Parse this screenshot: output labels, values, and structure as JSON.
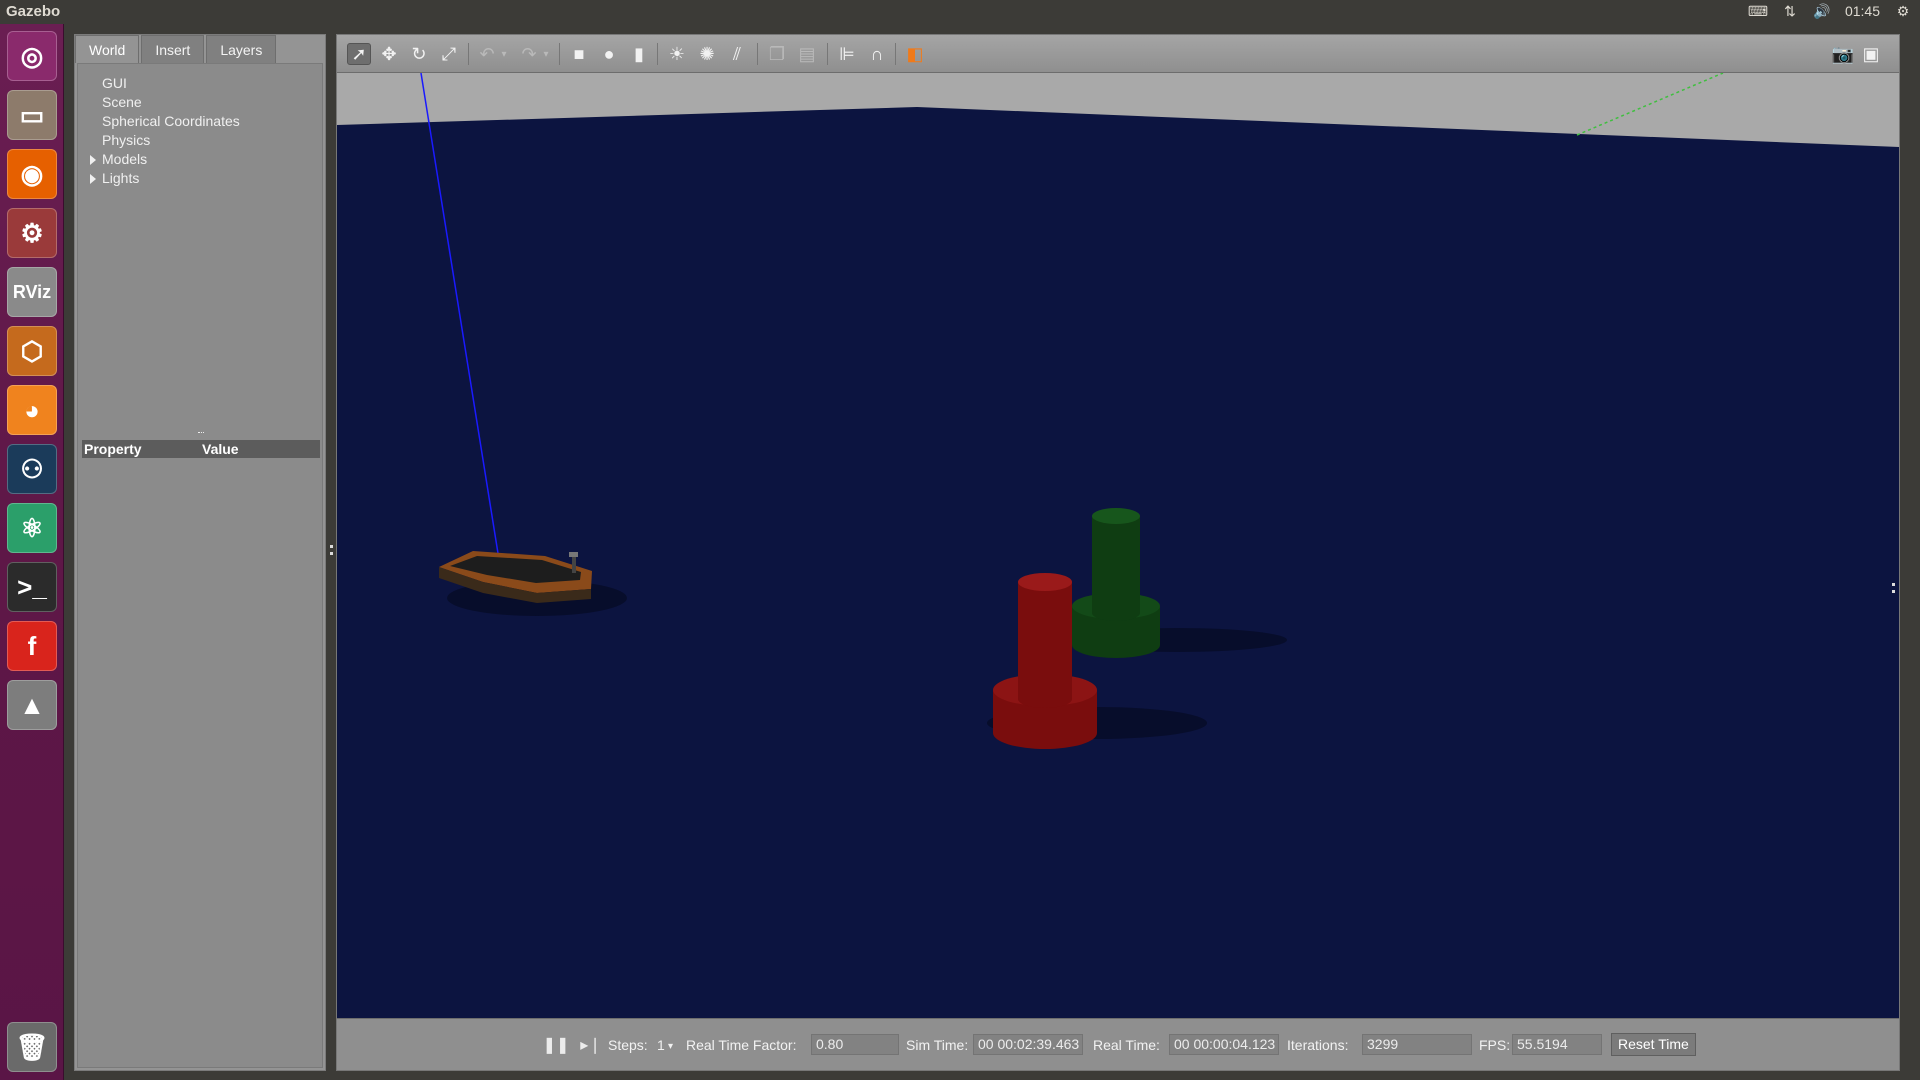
{
  "topbar": {
    "app_title": "Gazebo",
    "clock": "01:45",
    "indicator_icons": [
      "keyboard-icon",
      "network-icon",
      "volume-icon",
      "settings-gear-icon"
    ]
  },
  "launcher": {
    "items": [
      {
        "name": "ubuntu-dash-icon",
        "glyph": "◎",
        "bg": "#8a2a6c"
      },
      {
        "name": "files-icon",
        "glyph": "▭",
        "bg": "#8d7b6b"
      },
      {
        "name": "firefox-icon",
        "glyph": "◉",
        "bg": "#e66000"
      },
      {
        "name": "system-settings-icon",
        "glyph": "⚙",
        "bg": "#9a3a3a"
      },
      {
        "name": "rviz-icon",
        "glyph": "RViz",
        "bg": "#8a8a8a"
      },
      {
        "name": "gazebo-icon",
        "glyph": "⬡",
        "bg": "#c56a1d"
      },
      {
        "name": "blender-icon",
        "glyph": "◕",
        "bg": "#f0831e"
      },
      {
        "name": "steam-icon",
        "glyph": "⚇",
        "bg": "#1b3b5a"
      },
      {
        "name": "atom-icon",
        "glyph": "⚛",
        "bg": "#2b9f6a"
      },
      {
        "name": "terminal-icon",
        "glyph": ">_",
        "bg": "#2b2b2b"
      },
      {
        "name": "app-f-icon",
        "glyph": "f",
        "bg": "#d9241c"
      },
      {
        "name": "app-penguin-icon",
        "glyph": "▲",
        "bg": "#7d7d7d"
      }
    ],
    "trash": {
      "name": "trash-icon",
      "glyph": "🗑",
      "bg": "#6a6a6a"
    }
  },
  "leftpanel": {
    "tabs": [
      {
        "label": "World",
        "active": true
      },
      {
        "label": "Insert",
        "active": false
      },
      {
        "label": "Layers",
        "active": false
      }
    ],
    "tree": [
      {
        "label": "GUI",
        "expandable": false
      },
      {
        "label": "Scene",
        "expandable": false
      },
      {
        "label": "Spherical Coordinates",
        "expandable": false
      },
      {
        "label": "Physics",
        "expandable": false
      },
      {
        "label": "Models",
        "expandable": true
      },
      {
        "label": "Lights",
        "expandable": true
      }
    ],
    "property_header": {
      "property": "Property",
      "value": "Value"
    }
  },
  "toolbar": {
    "icons": [
      "select-arrow-icon",
      "translate-icon",
      "rotate-icon",
      "scale-icon",
      "undo-icon",
      "undo-dropdown-icon",
      "redo-icon",
      "redo-dropdown-icon",
      "box-shape-icon",
      "sphere-shape-icon",
      "cylinder-shape-icon",
      "point-light-icon",
      "spot-light-icon",
      "directional-light-icon",
      "copy-icon",
      "paste-icon",
      "align-icon",
      "snap-icon",
      "view-angle-icon",
      "screenshot-icon",
      "log-icon"
    ]
  },
  "statusbar": {
    "steps_label": "Steps:",
    "steps_value": "1",
    "rtf_label": "Real Time Factor:",
    "rtf_value": "0.80",
    "sim_time_label": "Sim Time:",
    "sim_time_value": "00 00:02:39.463",
    "real_time_label": "Real Time:",
    "real_time_value": "00 00:00:04.123",
    "iterations_label": "Iterations:",
    "iterations_value": "3299",
    "fps_label": "FPS:",
    "fps_value": "55.5194",
    "reset_label": "Reset Time"
  },
  "scene": {
    "colors": {
      "water": "#0c1440",
      "horizon": "#a9a9a9",
      "red_buoy": "#7a0d0d",
      "green_buoy": "#0f3d12",
      "boat_hull": "#8a4a1a",
      "z_axis": "#1a1aff",
      "grid_line": "#3fbf3f"
    }
  }
}
